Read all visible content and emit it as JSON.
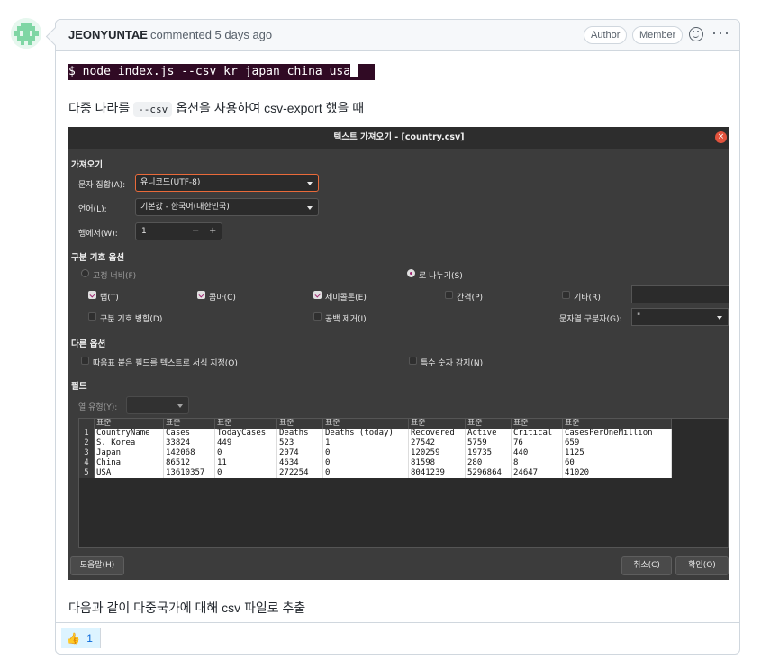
{
  "comment": {
    "author": "JEONYUNTAE",
    "meta": "commented 5 days ago",
    "badges": [
      "Author",
      "Member"
    ],
    "more": "···",
    "terminal_cmd": "$ node index.js --csv kr japan china usa",
    "para1_before": "다중 나라를",
    "para1_code": "--csv",
    "para1_after": "옵션을 사용하여 csv-export 했을 때",
    "para2": "다음과 같이 다중국가에 대해 csv 파일로 추출",
    "reaction": {
      "emoji": "👍",
      "count": "1"
    }
  },
  "dialog": {
    "title": "텍스트 가져오기 - [country.csv]",
    "close": "×",
    "import_section": "가져오기",
    "charset_label": "문자 집합(A):",
    "charset_value": "유니코드(UTF-8)",
    "language_label": "언어(L):",
    "language_value": "기본값 - 한국어(대한민국)",
    "from_row_label": "행에서(W):",
    "from_row_value": "1",
    "spin_minus": "−",
    "spin_plus": "+",
    "sep_section": "구분 기호 옵션",
    "fixed_width": "고정 너비(F)",
    "separated_by": "로 나누기(S)",
    "tab": "탭(T)",
    "comma": "콤마(C)",
    "semicolon": "세미콜론(E)",
    "space": "간격(P)",
    "other": "기타(R)",
    "merge": "구분 기호 병합(D)",
    "trim": "공백 제거(I)",
    "string_delim_label": "문자열 구분자(G):",
    "string_delim_value": "\"",
    "other_section": "다른 옵션",
    "quoted_as_text": "따옴표 붙은 필드를 텍스트로 서식 지정(O)",
    "detect_special": "특수 숫자 감지(N)",
    "fields_section": "필드",
    "column_type_label": "열 유형(Y):",
    "help_button": "도움말(H)",
    "cancel_button": "취소(C)",
    "ok_button": "확인(O)",
    "grid": {
      "type_header": "표준",
      "rows": [
        [
          "1",
          "CountryName",
          "Cases",
          "TodayCases",
          "Deaths",
          "Deaths (today)",
          "Recovered",
          "Active",
          "Critical",
          "CasesPerOneMillion"
        ],
        [
          "2",
          "S. Korea",
          "33824",
          "449",
          "523",
          "1",
          "27542",
          "5759",
          "76",
          "659"
        ],
        [
          "3",
          "Japan",
          "142068",
          "0",
          "2074",
          "0",
          "120259",
          "19735",
          "440",
          "1125"
        ],
        [
          "4",
          "China",
          "86512",
          "11",
          "4634",
          "0",
          "81598",
          "280",
          "8",
          "60"
        ],
        [
          "5",
          "USA",
          "13610357",
          "0",
          "272254",
          "0",
          "8041239",
          "5296864",
          "24647",
          "41020"
        ]
      ]
    }
  },
  "colors": {
    "terminal_bg": "#300a24",
    "dialog_bg": "#3c3c3c",
    "accent": "#e96a3a",
    "link": "#0969da"
  }
}
